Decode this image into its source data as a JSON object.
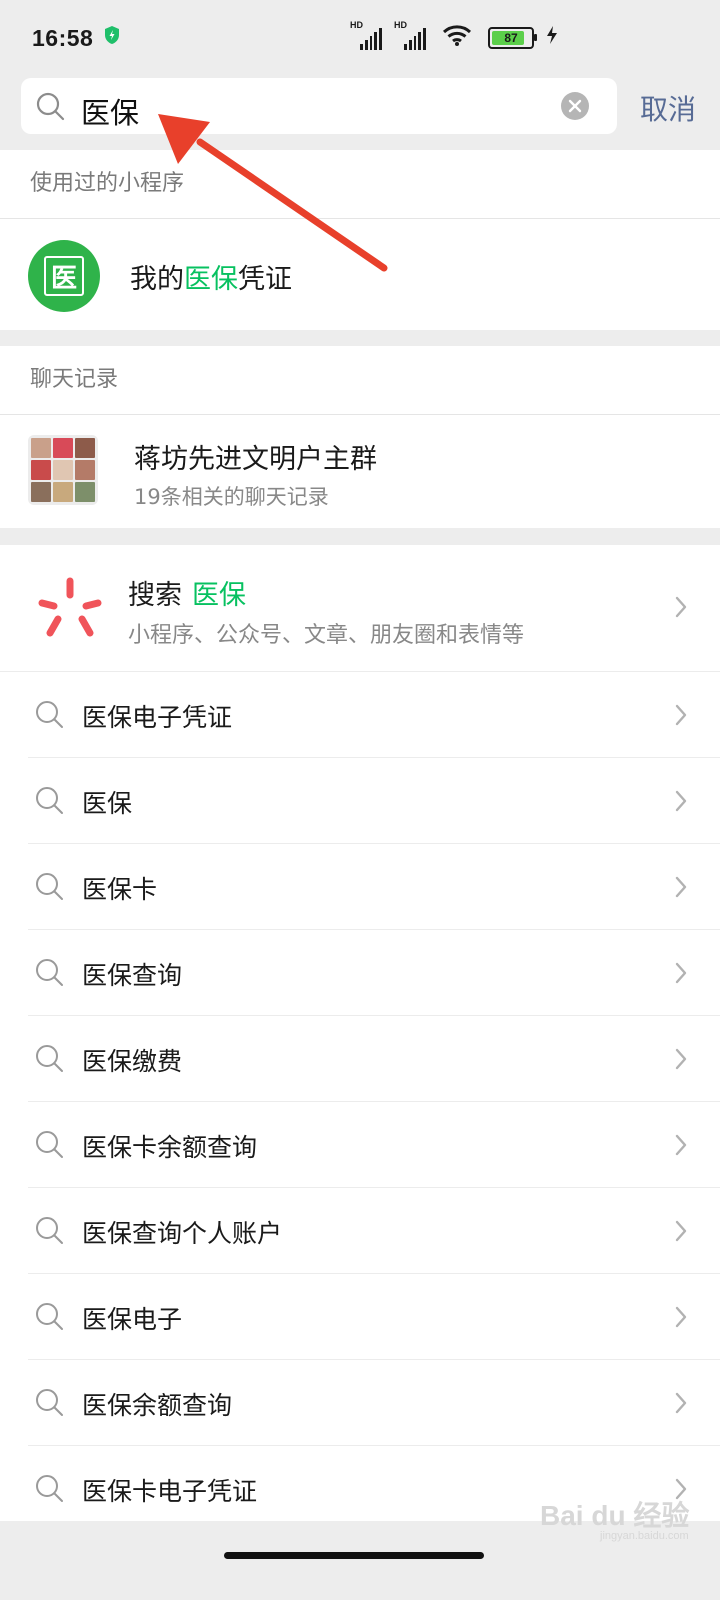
{
  "status_bar": {
    "time": "16:58",
    "network_label": "HD",
    "battery": "87"
  },
  "search": {
    "query": "医保",
    "cancel_label": "取消"
  },
  "recent_miniprograms": {
    "header": "使用过的小程序",
    "items": [
      {
        "avatar_char": "医",
        "title_prefix": "我的",
        "title_highlight": "医保",
        "title_suffix": "凭证"
      }
    ]
  },
  "chat_history": {
    "header": "聊天记录",
    "items": [
      {
        "title": "蒋坊先进文明户主群",
        "subtitle": "19条相关的聊天记录"
      }
    ]
  },
  "search_entry": {
    "label": "搜索",
    "keyword": "医保",
    "subtitle": "小程序、公众号、文章、朋友圈和表情等"
  },
  "suggestions": [
    "医保电子凭证",
    "医保",
    "医保卡",
    "医保查询",
    "医保缴费",
    "医保卡余额查询",
    "医保查询个人账户",
    "医保电子",
    "医保余额查询",
    "医保卡电子凭证"
  ],
  "watermark": {
    "text": "Bai du 经验",
    "sub": "jingyan.baidu.com"
  },
  "colors": {
    "highlight": "#07c160",
    "cancel": "#576b95",
    "arrow": "#e8402b"
  }
}
